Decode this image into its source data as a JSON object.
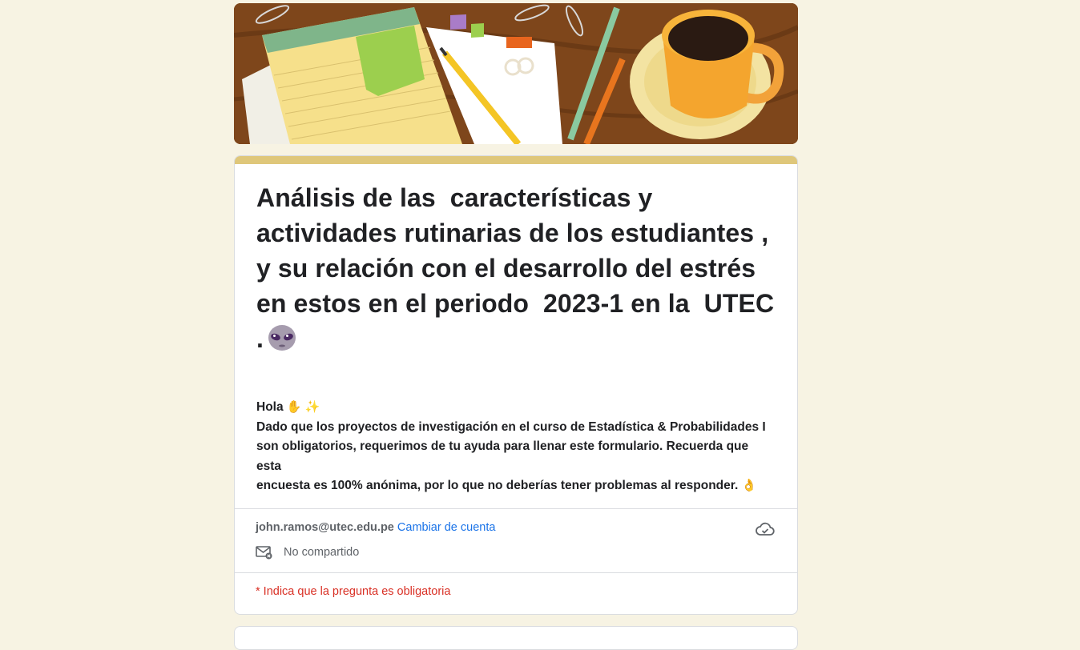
{
  "banner": {
    "icon": "desk-notepad-coffee-illustration"
  },
  "form": {
    "title": "Análisis de las  características y actividades rutinarias de los estudiantes , y su relación con el desarrollo del estrés en estos en el periodo  2023-1 en la  UTEC .",
    "title_emoji": "alien-emoji",
    "description": {
      "greeting": "Hola",
      "greeting_emojis": "✋ ✨",
      "line1": "Dado que los proyectos de investigación en el  curso de Estadística & Probabilidades I",
      "line2": "son obligatorios, requerimos de tu ayuda para llenar este formulario. Recuerda que esta",
      "line3": "encuesta es 100% anónima, por lo que no deberías tener problemas al responder.",
      "ok_emoji": "👌"
    }
  },
  "account": {
    "email": "john.ramos@utec.edu.pe",
    "switch_label": "Cambiar de cuenta",
    "shared_status": "No compartido",
    "cloud_icon": "cloud-saved-icon",
    "mail_icon": "mail-not-shared-icon"
  },
  "required_note": "* Indica que la pregunta es obligatoria",
  "colors": {
    "accent": "#dfc77a",
    "link": "#1a73e8",
    "required": "#d93025",
    "background": "#f7f3e3"
  }
}
